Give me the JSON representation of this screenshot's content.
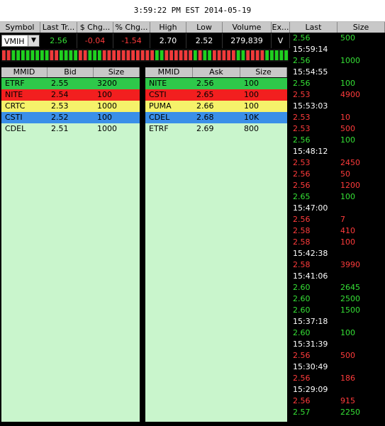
{
  "title": "3:59:22 PM EST 2014-05-19",
  "quote_headers": [
    "Symbol",
    "Last Tr...",
    "$ Chg...",
    "% Chg...",
    "High",
    "Low",
    "Volume",
    "Ex..."
  ],
  "quote": {
    "symbol": "VMIH",
    "last": "2.56",
    "chg": "-0.04",
    "pct_chg": "-1.54",
    "high": "2.70",
    "low": "2.52",
    "volume": "279,839",
    "exchange": "V"
  },
  "tick_bar_pattern": [
    "red",
    "red",
    "green",
    "green",
    "green",
    "green",
    "green",
    "green",
    "green",
    "green",
    "red",
    "red",
    "green",
    "green",
    "green",
    "green",
    "red",
    "red",
    "green",
    "green",
    "green",
    "red",
    "red",
    "red",
    "red",
    "red",
    "red",
    "red",
    "red",
    "red",
    "red",
    "red",
    "green",
    "green",
    "red",
    "red",
    "red",
    "red",
    "red",
    "red",
    "green",
    "red",
    "green",
    "green",
    "red",
    "red",
    "red",
    "red",
    "red",
    "green",
    "green",
    "red",
    "red",
    "red",
    "red",
    "green",
    "green",
    "green",
    "green",
    "green"
  ],
  "bid_book": {
    "headers": [
      "MMID",
      "Bid",
      "Size"
    ],
    "rows": [
      {
        "mmid": "ETRF",
        "price": "2.55",
        "size": "3200",
        "bg": "#2ec84a"
      },
      {
        "mmid": "NITE",
        "price": "2.54",
        "size": "100",
        "bg": "#f21f1f"
      },
      {
        "mmid": "CRTC",
        "price": "2.53",
        "size": "1000",
        "bg": "#f5f26a"
      },
      {
        "mmid": "CSTI",
        "price": "2.52",
        "size": "100",
        "bg": "#3a8fe8"
      },
      {
        "mmid": "CDEL",
        "price": "2.51",
        "size": "1000",
        "bg": "#c9f5cc"
      }
    ]
  },
  "ask_book": {
    "headers": [
      "MMID",
      "Ask",
      "Size"
    ],
    "rows": [
      {
        "mmid": "NITE",
        "price": "2.56",
        "size": "100",
        "bg": "#2ec84a"
      },
      {
        "mmid": "CSTI",
        "price": "2.65",
        "size": "100",
        "bg": "#f21f1f"
      },
      {
        "mmid": "PUMA",
        "price": "2.66",
        "size": "100",
        "bg": "#f5f26a"
      },
      {
        "mmid": "CDEL",
        "price": "2.68",
        "size": "10K",
        "bg": "#3a8fe8"
      },
      {
        "mmid": "ETRF",
        "price": "2.69",
        "size": "800",
        "bg": "#c9f5cc"
      }
    ]
  },
  "trades_headers": [
    "Last",
    "Size"
  ],
  "trades": [
    {
      "price": "2.56",
      "size": "500",
      "color": "#35e035"
    },
    {
      "time": "15:59:14"
    },
    {
      "price": "2.56",
      "size": "1000",
      "color": "#35e035"
    },
    {
      "time": "15:54:55"
    },
    {
      "price": "2.56",
      "size": "100",
      "color": "#35e035"
    },
    {
      "price": "2.53",
      "size": "4900",
      "color": "#ff3b3b"
    },
    {
      "time": "15:53:03"
    },
    {
      "price": "2.53",
      "size": "10",
      "color": "#ff3b3b"
    },
    {
      "price": "2.53",
      "size": "500",
      "color": "#ff3b3b"
    },
    {
      "price": "2.56",
      "size": "100",
      "color": "#35e035"
    },
    {
      "time": "15:48:12"
    },
    {
      "price": "2.53",
      "size": "2450",
      "color": "#ff3b3b"
    },
    {
      "price": "2.56",
      "size": "50",
      "color": "#ff3b3b"
    },
    {
      "price": "2.56",
      "size": "1200",
      "color": "#ff3b3b"
    },
    {
      "price": "2.65",
      "size": "100",
      "color": "#35e035"
    },
    {
      "time": "15:47:00"
    },
    {
      "price": "2.56",
      "size": "7",
      "color": "#ff3b3b"
    },
    {
      "price": "2.58",
      "size": "410",
      "color": "#ff3b3b"
    },
    {
      "price": "2.58",
      "size": "100",
      "color": "#ff3b3b"
    },
    {
      "time": "15:42:38"
    },
    {
      "price": "2.58",
      "size": "3990",
      "color": "#ff3b3b"
    },
    {
      "time": "15:41:06"
    },
    {
      "price": "2.60",
      "size": "2645",
      "color": "#35e035"
    },
    {
      "price": "2.60",
      "size": "2500",
      "color": "#35e035"
    },
    {
      "price": "2.60",
      "size": "1500",
      "color": "#35e035"
    },
    {
      "time": "15:37:18"
    },
    {
      "price": "2.60",
      "size": "100",
      "color": "#35e035"
    },
    {
      "time": "15:31:39"
    },
    {
      "price": "2.56",
      "size": "500",
      "color": "#ff3b3b"
    },
    {
      "time": "15:30:49"
    },
    {
      "price": "2.56",
      "size": "186",
      "color": "#ff3b3b"
    },
    {
      "time": "15:29:09"
    },
    {
      "price": "2.56",
      "size": "915",
      "color": "#ff3b3b"
    },
    {
      "price": "2.57",
      "size": "2250",
      "color": "#35e035"
    }
  ]
}
